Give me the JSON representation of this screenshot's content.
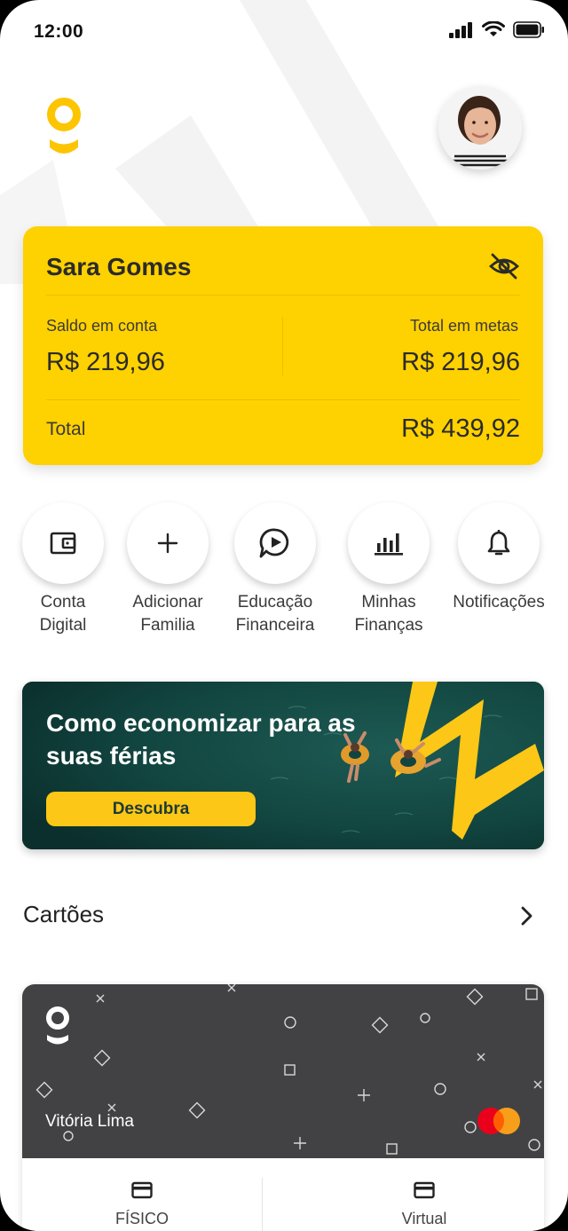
{
  "status_bar": {
    "time": "12:00"
  },
  "balance": {
    "name": "Sara Gomes",
    "account_label": "Saldo em conta",
    "account_value": "R$ 219,96",
    "goals_label": "Total em metas",
    "goals_value": "R$ 219,96",
    "total_label": "Total",
    "total_value": "R$ 439,92"
  },
  "actions": [
    {
      "label": "Conta\nDigital",
      "icon": "wallet-icon"
    },
    {
      "label": "Adicionar\nFamilia",
      "icon": "plus-icon"
    },
    {
      "label": "Educação\nFinanceira",
      "icon": "chat-play-icon"
    },
    {
      "label": "Minhas\nFinanças",
      "icon": "bar-chart-icon"
    },
    {
      "label": "Notificações",
      "icon": "bell-icon"
    }
  ],
  "banner": {
    "title": "Como economizar para as suas férias",
    "button": "Descubra"
  },
  "cards_section": {
    "title": "Cartões",
    "holder": "Vitória Lima",
    "tabs": [
      "FÍSICO",
      "Virtual"
    ]
  },
  "colors": {
    "brand_yellow": "#fed100",
    "banner_button": "#fcc716",
    "card_dark": "#424244",
    "banner_bg": "#0f3b37"
  }
}
